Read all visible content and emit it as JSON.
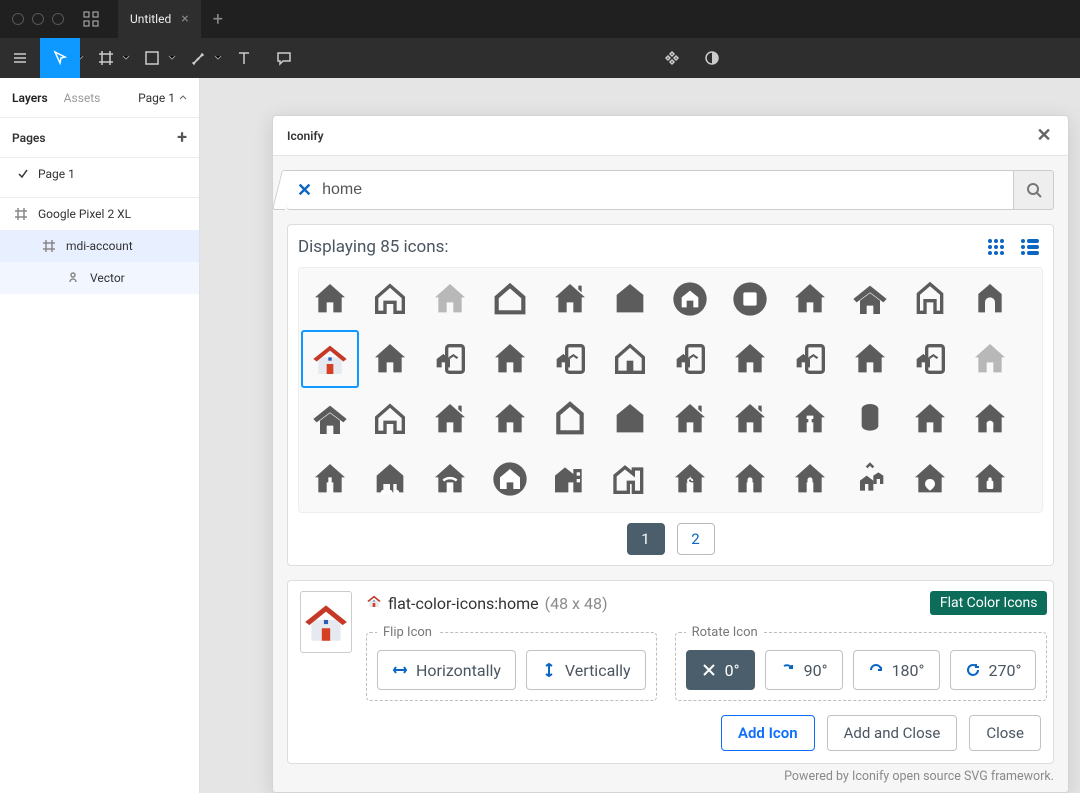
{
  "titlebar": {
    "tab_label": "Untitled"
  },
  "left_panel": {
    "tabs": {
      "layers": "Layers",
      "assets": "Assets"
    },
    "page_selector": "Page 1",
    "pages_header": "Pages",
    "pages": [
      "Page 1"
    ],
    "layers": [
      {
        "name": "Google Pixel 2 XL",
        "indent": 0,
        "type": "frame",
        "selected": false
      },
      {
        "name": "mdi-account",
        "indent": 1,
        "type": "frame",
        "selected": true
      },
      {
        "name": "Vector",
        "indent": 2,
        "type": "vector",
        "selected": false
      }
    ]
  },
  "modal": {
    "title": "Iconify",
    "search_value": "home",
    "results_status_prefix": "Displaying ",
    "results_count": "85",
    "results_status_suffix": " icons:",
    "pages": [
      "1",
      "2"
    ],
    "active_page": "1",
    "detail": {
      "id": "flat-color-icons:home",
      "dims": "(48 x 48)",
      "collection_badge": "Flat Color Icons",
      "flip_legend": "Flip Icon",
      "flip_h": "Horizontally",
      "flip_v": "Vertically",
      "rotate_legend": "Rotate Icon",
      "rot_0": "0°",
      "rot_90": "90°",
      "rot_180": "180°",
      "rot_270": "270°"
    },
    "actions": {
      "add": "Add Icon",
      "add_close": "Add and Close",
      "close": "Close"
    },
    "footer": "Powered by Iconify open source SVG framework."
  }
}
